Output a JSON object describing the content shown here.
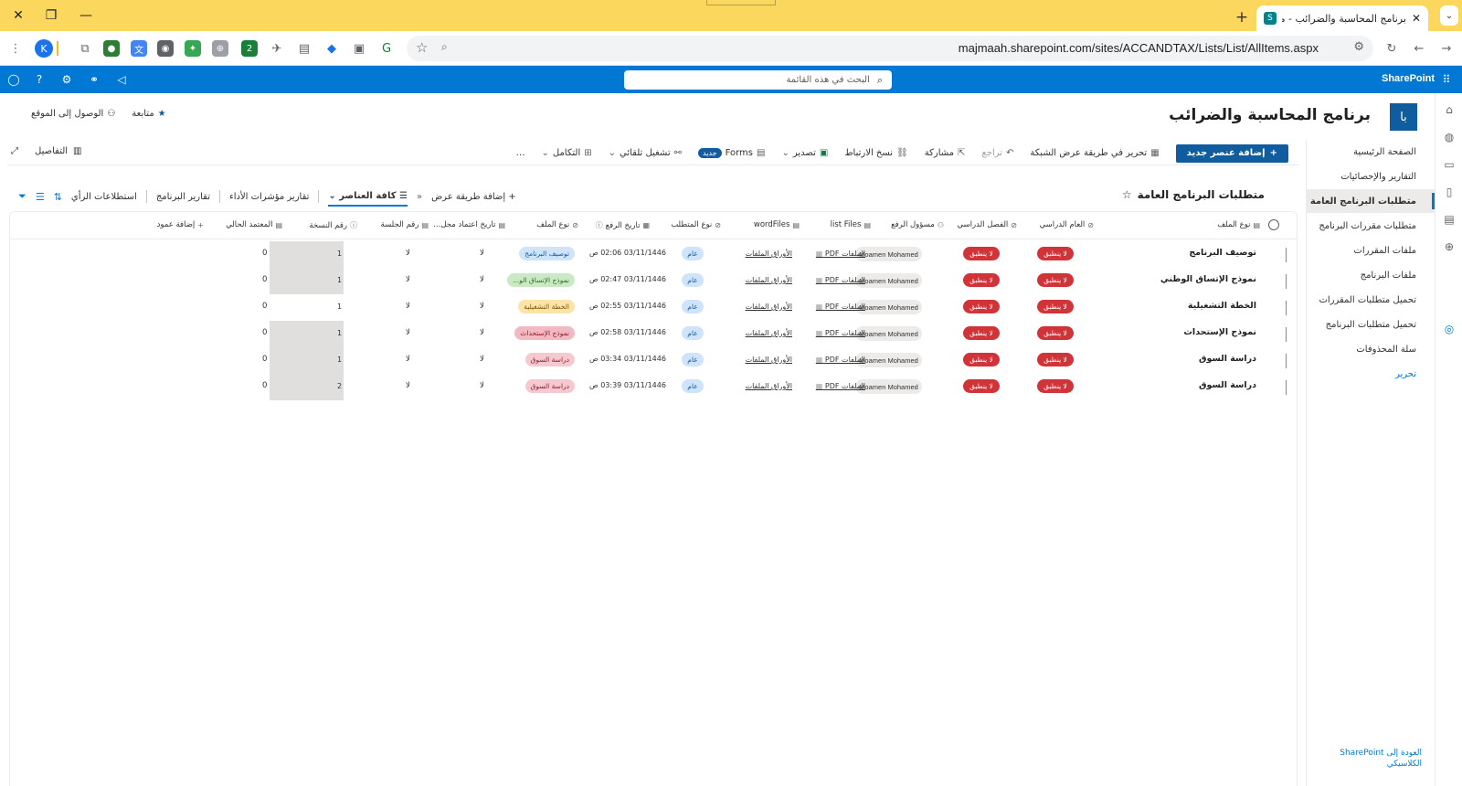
{
  "browser": {
    "tab_title": "برنامج المحاسبة والضرائب - متطل",
    "url": "majmaah.sharepoint.com/sites/ACCANDTAX/Lists/List/AllItems.aspx",
    "avatar_letter": "K",
    "ext_badge": "2"
  },
  "suite": {
    "brand": "SharePoint",
    "search_placeholder": "البحث في هذه القائمة"
  },
  "site": {
    "logo_text": "با",
    "title": "برنامج المحاسبة والضرائب",
    "follow_label": "متابعة",
    "site_access_label": "الوصول إلى الموقع"
  },
  "nav": {
    "items": [
      {
        "label": "الصفحة الرئيسية"
      },
      {
        "label": "التقارير والإحصائيات"
      },
      {
        "label": "متطلبات البرنامج العامة"
      },
      {
        "label": "متطلبات مقررات البرنامج"
      },
      {
        "label": "ملفات المقررات"
      },
      {
        "label": "ملفات البرنامج"
      },
      {
        "label": "تحميل متطلبات المقررات"
      },
      {
        "label": "تحميل متطلبات البرنامج"
      },
      {
        "label": "سلة المحذوفات"
      },
      {
        "label": "تحرير"
      }
    ],
    "bottom_link": "العودة إلى SharePoint الكلاسيكي"
  },
  "command": {
    "new_item": "إضافة عنصر جديد",
    "grid_edit": "تحرير في طريقة عرض الشبكة",
    "undo": "تراجع",
    "share": "مشاركة",
    "copy_link": "نسخ الارتباط",
    "export": "تصدير",
    "forms": "Forms",
    "forms_badge": "جديد",
    "automate": "تشغيل تلقائي",
    "integrate": "التكامل",
    "more": "…",
    "details": "التفاصيل"
  },
  "viewbar": {
    "list_title": "متطلبات البرنامج العامة",
    "views": [
      "استطلاعات الرأي",
      "تقارير البرنامج",
      "تقارير مؤشرات الأداء",
      "كافة العناصر"
    ],
    "add_view": "إضافة طريقة عرض"
  },
  "grid": {
    "columns": [
      "نوع الملف",
      "العام الدراسي",
      "الفصل الدراسي",
      "مسؤول الرفع",
      "list Files",
      "wordFiles",
      "نوع المتطلب",
      "تاريخ الرفع",
      "نوع الملف",
      "تاريخ اعتماد مجل...",
      "رقم الجلسة",
      "رقم النسخة",
      "المعتمد الحالي",
      "إضافة عمود"
    ],
    "rows": [
      {
        "title": "توصيف البرنامج",
        "year": "لا ينطبق",
        "semester": "لا ينطبق",
        "uploader": "Moamen Mohamed",
        "list_files": "الملفات PDF",
        "word_files": "الأوراق الملفات",
        "req_type": "عام",
        "date": "03/11/1446 02:06 ص",
        "type": "توصيف البرنامج",
        "type_color": "#cfe4fa",
        "type_text": "#0f5c9e",
        "approval_date": "لا",
        "session": "لا",
        "version": "1",
        "current": "0",
        "shaded": true
      },
      {
        "title": "نموذج الإتساق الوطني",
        "year": "لا ينطبق",
        "semester": "لا ينطبق",
        "uploader": "Moamen Mohamed",
        "list_files": "الملفات PDF",
        "word_files": "الأوراق الملفات",
        "req_type": "عام",
        "date": "03/11/1446 02:47 ص",
        "type": "نموذج الإتساق الو...",
        "type_color": "#caeac4",
        "type_text": "#2f6b2a",
        "approval_date": "لا",
        "session": "لا",
        "version": "1",
        "current": "0",
        "shaded": true
      },
      {
        "title": "الخطة التشغيلية",
        "year": "لا ينطبق",
        "semester": "لا ينطبق",
        "uploader": "Moamen Mohamed",
        "list_files": "الملفات PDF",
        "word_files": "الأوراق الملفات",
        "req_type": "عام",
        "date": "03/11/1446 02:55 ص",
        "type": "الخطة التشغيلية",
        "type_color": "#fce4a8",
        "type_text": "#7a5a00",
        "approval_date": "لا",
        "session": "لا",
        "version": "1",
        "current": "0",
        "shaded": false
      },
      {
        "title": "نموذج الإستحداث",
        "year": "لا ينطبق",
        "semester": "لا ينطبق",
        "uploader": "Moamen Mohamed",
        "list_files": "الملفات PDF",
        "word_files": "الأوراق الملفات",
        "req_type": "عام",
        "date": "03/11/1446 02:58 ص",
        "type": "نموذج الإستحداث",
        "type_color": "#f4b8c2",
        "type_text": "#8a1f30",
        "approval_date": "لا",
        "session": "لا",
        "version": "1",
        "current": "0",
        "shaded": true
      },
      {
        "title": "دراسة السوق",
        "year": "لا ينطبق",
        "semester": "لا ينطبق",
        "uploader": "Moamen Mohamed",
        "list_files": "الملفات PDF",
        "word_files": "الأوراق الملفات",
        "req_type": "عام",
        "date": "03/11/1446 03:34 ص",
        "type": "دراسة السوق",
        "type_color": "#f6c9d0",
        "type_text": "#8a1f30",
        "approval_date": "لا",
        "session": "لا",
        "version": "1",
        "current": "0",
        "shaded": true
      },
      {
        "title": "دراسة السوق",
        "year": "لا ينطبق",
        "semester": "لا ينطبق",
        "uploader": "Moamen Mohamed",
        "list_files": "الملفات PDF",
        "word_files": "الأوراق الملفات",
        "req_type": "عام",
        "date": "03/11/1446 03:39 ص",
        "type": "دراسة السوق",
        "type_color": "#f6c9d0",
        "type_text": "#8a1f30",
        "approval_date": "لا",
        "session": "لا",
        "version": "2",
        "current": "0",
        "shaded": true
      }
    ]
  },
  "colors": {
    "accent": "#0078d4",
    "suitebar": "#0078d4",
    "tabstrip": "#fbd85d",
    "not_applicable": "#d13438",
    "primary_button": "#0f5c9e"
  }
}
